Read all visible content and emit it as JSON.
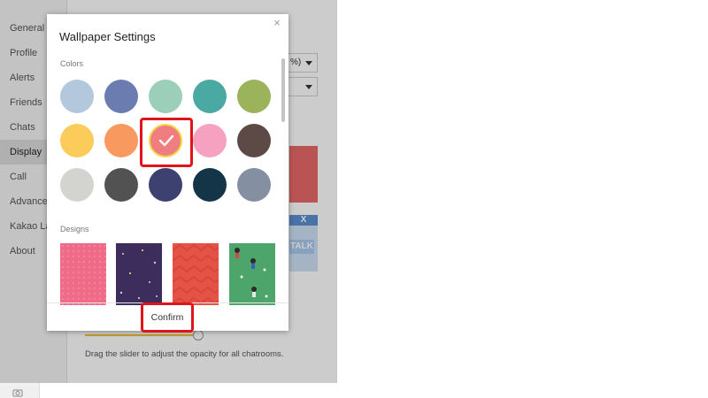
{
  "sidebar": {
    "items": [
      {
        "label": "General"
      },
      {
        "label": "Profile"
      },
      {
        "label": "Alerts"
      },
      {
        "label": "Friends"
      },
      {
        "label": "Chats"
      },
      {
        "label": "Display",
        "active": true
      },
      {
        "label": "Call"
      },
      {
        "label": "Advanced"
      },
      {
        "label": "Kakao Labs"
      },
      {
        "label": "About"
      }
    ]
  },
  "background": {
    "dropdown_value": "%)",
    "preview_close": "X",
    "preview_talk": "TALK",
    "opacity_hint": "Drag the slider to adjust the opacity for all chatrooms.",
    "opacity_level_fraction": 0.96
  },
  "modal": {
    "title": "Wallpaper Settings",
    "close_glyph": "×",
    "colors_label": "Colors",
    "designs_label": "Designs",
    "confirm_label": "Confirm",
    "colors": [
      "#b3c8dc",
      "#6b7db0",
      "#9bcfba",
      "#4ba9a3",
      "#9bb35a",
      "#fbcc5a",
      "#f89a5f",
      "#f07e80",
      "#f5a1bf",
      "#5d4a46",
      "#d3d4cf",
      "#525252",
      "#3d4170",
      "#143548",
      "#848fa1"
    ],
    "selected_color_index": 7,
    "designs": [
      {
        "name": "pink-pattern",
        "color": "#f06b88"
      },
      {
        "name": "purple-starry",
        "color": "#3c2d5c"
      },
      {
        "name": "red-chevron",
        "color": "#e55347"
      },
      {
        "name": "green-characters",
        "color": "#4ea56b"
      }
    ]
  },
  "colors": {
    "annotation": "#e0141b",
    "accent_yellow": "#f1c232"
  }
}
